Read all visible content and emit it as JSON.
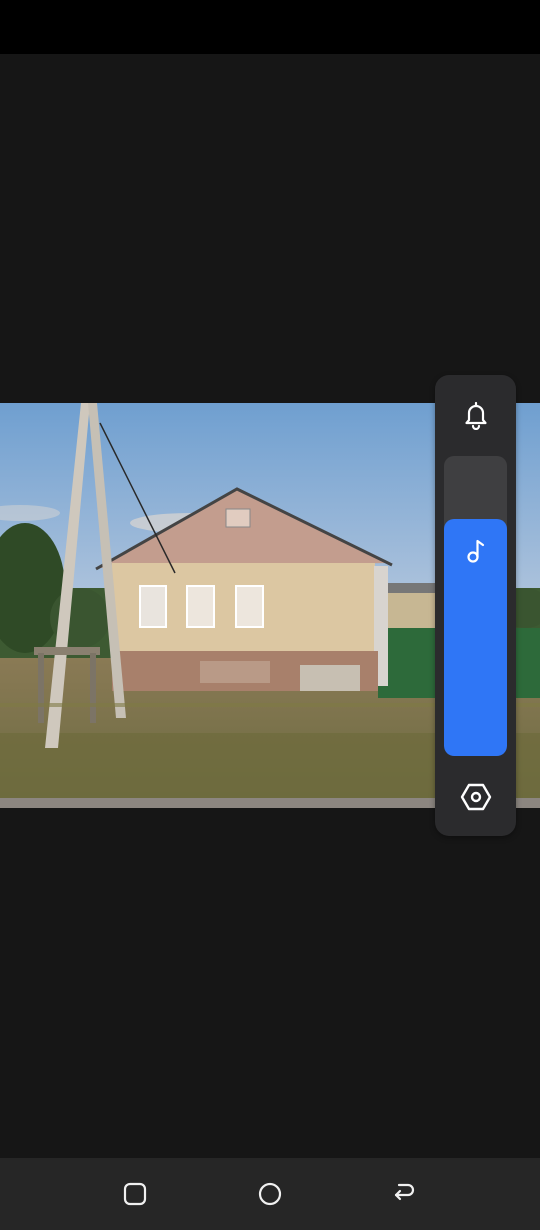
{
  "status_bar": {},
  "photo": {
    "description_icon": "photo-image"
  },
  "volume_panel": {
    "top_icon": "bell-icon",
    "slider_icon": "music-note-icon",
    "bottom_icon": "settings-icon",
    "level_fraction": 0.79,
    "accent_color": "#2f76f6",
    "panel_color": "#2b2b2d",
    "track_color": "#3f3f41"
  },
  "nav_bar": {
    "recents_icon": "square-icon",
    "home_icon": "circle-icon",
    "back_icon": "back-arrow-icon"
  }
}
